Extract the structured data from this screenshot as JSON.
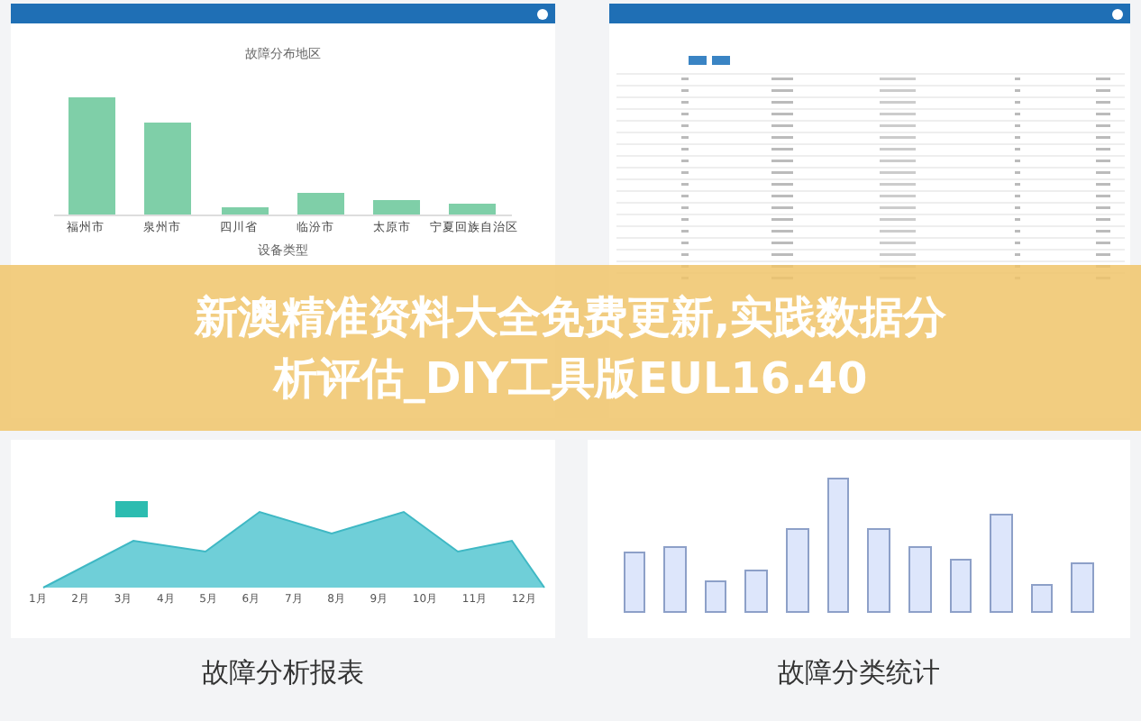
{
  "region_chart": {
    "title": "故障分布地区",
    "categories": [
      "福州市",
      "泉州市",
      "四川省",
      "临汾市",
      "太原市",
      "宁夏回族自治区"
    ]
  },
  "device_chart": {
    "title": "设备类型"
  },
  "month_chart": {
    "categories": [
      "1月",
      "2月",
      "3月",
      "4月",
      "5月",
      "6月",
      "7月",
      "8月",
      "9月",
      "10月",
      "11月",
      "12月"
    ]
  },
  "captions": [
    "故障分析报表",
    "故障分类统计"
  ],
  "banner": {
    "lines": [
      "新澳精准资料大全免费更新,实践数据分",
      "析评估_DIY工具版EUL16.40"
    ]
  }
}
